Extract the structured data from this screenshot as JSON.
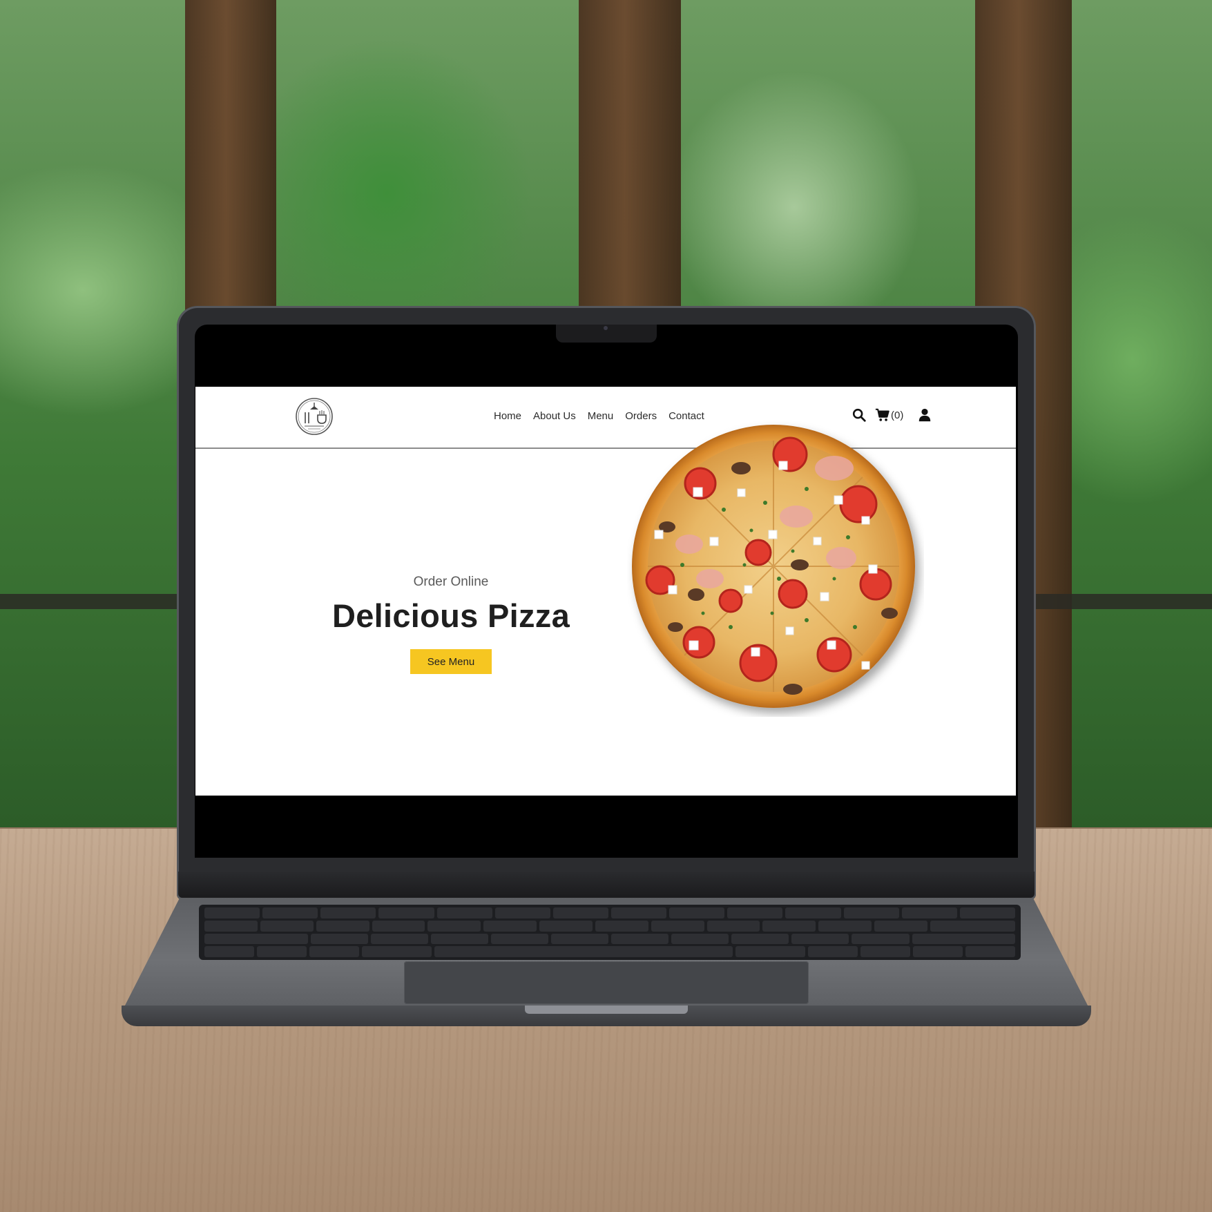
{
  "site": {
    "nav": {
      "items": [
        {
          "label": "Home"
        },
        {
          "label": "About Us"
        },
        {
          "label": "Menu"
        },
        {
          "label": "Orders"
        },
        {
          "label": "Contact"
        }
      ]
    },
    "header_icons": {
      "search": "search-icon",
      "cart": "cart-icon",
      "cart_count": "(0)",
      "user": "user-icon"
    },
    "hero": {
      "subtitle": "Order Online",
      "title": "Delicious Pizza",
      "button_label": "See Menu",
      "button_color": "#f6c621"
    }
  },
  "colors": {
    "accent": "#f6c621",
    "text": "#1f1f1f"
  }
}
